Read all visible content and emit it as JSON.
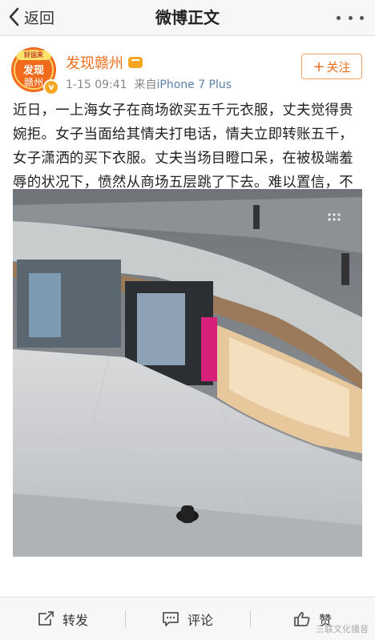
{
  "nav": {
    "back_label": "返回",
    "title": "微博正文"
  },
  "author": {
    "avatar_badge": "好运来",
    "avatar_line1": "发现",
    "avatar_line2": "赣州",
    "name": "发现赣州",
    "time": "1-15 09:41",
    "source_prefix": "来自",
    "source": "iPhone 7 Plus",
    "follow_label": "关注",
    "follow_plus": "+"
  },
  "post": {
    "text": "近日，一上海女子在商场欲买五千元衣服，丈夫觉得贵婉拒。女子当面给其情夫打电话，情夫立即转账五千，女子潇洒的买下衣服。丈夫当场目瞪口呆，在被极端羞辱的状况下，愤然从商场五层跳了下去。难以置信，不值得！"
  },
  "actions": {
    "repost": "转发",
    "comment": "评论",
    "like": "赞"
  },
  "watermark": "三联文化播音",
  "colors": {
    "accent": "#f06f1d",
    "link": "#5a7faa"
  }
}
